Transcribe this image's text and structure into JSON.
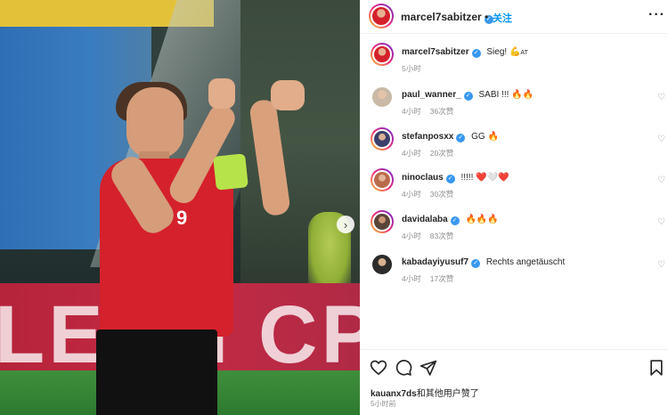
{
  "photo": {
    "ad_text": "LEAN CP",
    "jersey_number": "9",
    "next_icon": "›"
  },
  "header": {
    "username": "marcel7sabitzer",
    "verified_icon": "✓",
    "dot": "•",
    "follow_label": "关注",
    "more_icon": "···"
  },
  "caption": {
    "username": "marcel7sabitzer",
    "text": "Sieg!",
    "emoji": "💪",
    "flag": "AT",
    "time": "5小时"
  },
  "comments": [
    {
      "username": "paul_wanner_",
      "text": "SABI !!!",
      "emoji": "🔥🔥",
      "time": "4小时",
      "likes": "36次赞",
      "ring": false,
      "avatar_color": "#c9b9a6"
    },
    {
      "username": "stefanposxx",
      "text": "GG",
      "emoji": "🔥",
      "time": "4小时",
      "likes": "20次赞",
      "ring": true,
      "avatar_color": "#3b3f6b"
    },
    {
      "username": "ninoclaus",
      "text": "!!!!!",
      "emoji": "❤️🤍❤️",
      "time": "4小时",
      "likes": "30次赞",
      "ring": true,
      "avatar_color": "#b96b4c"
    },
    {
      "username": "davidalaba",
      "text": "",
      "emoji": "🔥🔥🔥",
      "time": "4小时",
      "likes": "83次赞",
      "ring": true,
      "avatar_color": "#5a4438"
    },
    {
      "username": "kabadayiyusuf7",
      "text": "Rechts angetäuscht",
      "emoji": "",
      "time": "4小时",
      "likes": "17次赞",
      "ring": false,
      "avatar_color": "#2b2b2b"
    }
  ],
  "like_icon": "♡",
  "actions": {
    "liked_by_user": "kauanx7ds",
    "liked_by_rest": "和其他用户赞了",
    "time": "5小时前"
  },
  "colors": {
    "accent": "#0095f6",
    "verified": "#3897f0",
    "muted": "#8e8e8e",
    "jersey_red": "#d4212c",
    "captain_band": "#b7e34a"
  }
}
